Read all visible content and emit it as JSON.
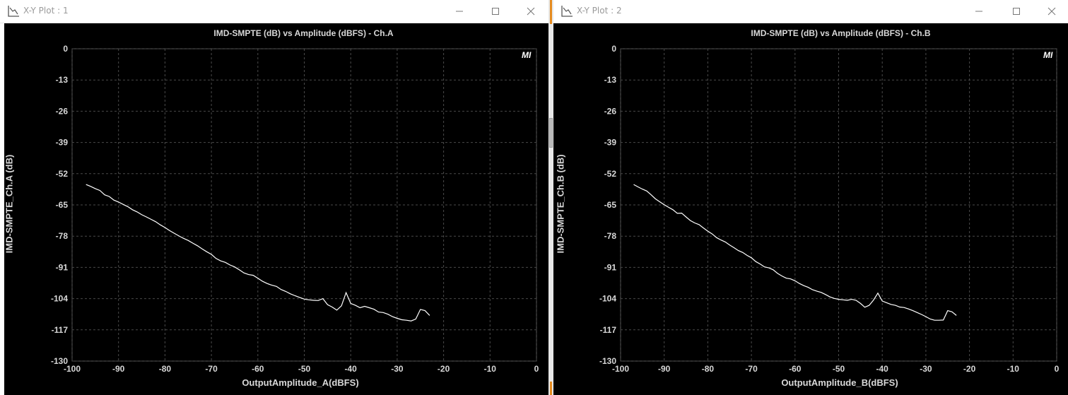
{
  "windows": [
    {
      "title": "X-Y Plot : 1",
      "controls": {
        "minimize": "minimize-icon",
        "maximize": "maximize-icon",
        "close": "close-icon"
      },
      "badge": "MI",
      "chart_data": {
        "type": "line",
        "title": "IMD-SMPTE (dB) vs Amplitude (dBFS) - Ch.A",
        "xlabel": "OutputAmplitude_A(dBFS)",
        "ylabel": "IMD-SMPTE_Ch.A (dB)",
        "xlim": [
          -100,
          0
        ],
        "ylim": [
          -130,
          0
        ],
        "xticks": [
          -100,
          -90,
          -80,
          -70,
          -60,
          -50,
          -40,
          -30,
          -20,
          -10,
          0
        ],
        "yticks": [
          0,
          -13,
          -26,
          -39,
          -52,
          -65,
          -78,
          -91,
          -104,
          -117,
          -130
        ],
        "grid": true,
        "line_color": "#ffffff",
        "series": [
          {
            "x": [
              -97,
              -96,
              -95,
              -94,
              -93,
              -92,
              -91,
              -90,
              -89,
              -88,
              -87,
              -86,
              -85,
              -84,
              -83,
              -82,
              -81,
              -80,
              -79,
              -78,
              -77,
              -76,
              -75,
              -74,
              -73,
              -72,
              -71,
              -70,
              -69,
              -68,
              -67,
              -66,
              -65,
              -64,
              -63,
              -62,
              -61,
              -60,
              -59,
              -58,
              -57,
              -56,
              -55,
              -54,
              -53,
              -52,
              -51,
              -50,
              -49,
              -48,
              -47,
              -46,
              -45,
              -44,
              -43,
              -42,
              -41,
              -40,
              -39,
              -38,
              -37,
              -36,
              -35,
              -34,
              -33,
              -32,
              -31,
              -30,
              -29,
              -28,
              -27,
              -26,
              -25,
              -24,
              -23
            ],
            "y": [
              -56.5,
              -57.3,
              -58.2,
              -59.0,
              -60.8,
              -61.5,
              -63.0,
              -63.8,
              -64.8,
              -65.7,
              -67.0,
              -67.9,
              -69.1,
              -70.0,
              -71.0,
              -72.0,
              -73.3,
              -74.4,
              -75.7,
              -76.8,
              -77.9,
              -78.9,
              -79.8,
              -80.9,
              -82.0,
              -83.3,
              -84.5,
              -85.6,
              -87.3,
              -88.3,
              -88.9,
              -90.0,
              -90.8,
              -92.0,
              -93.3,
              -94.0,
              -94.3,
              -95.5,
              -96.8,
              -97.7,
              -98.4,
              -98.9,
              -100.2,
              -101.0,
              -102.0,
              -102.8,
              -103.5,
              -104.2,
              -104.5,
              -104.7,
              -104.8,
              -104.0,
              -106.5,
              -107.5,
              -108.8,
              -107.0,
              -101.5,
              -106.0,
              -106.8,
              -107.8,
              -107.2,
              -107.8,
              -108.4,
              -109.6,
              -109.8,
              -110.5,
              -111.5,
              -112.2,
              -112.8,
              -113.0,
              -113.3,
              -112.5,
              -108.5,
              -109.0,
              -111.0
            ]
          }
        ]
      }
    },
    {
      "title": "X-Y Plot : 2",
      "controls": {
        "minimize": "minimize-icon",
        "maximize": "maximize-icon",
        "close": "close-icon"
      },
      "badge": "MI",
      "chart_data": {
        "type": "line",
        "title": "IMD-SMPTE (dB) vs Amplitude (dBFS) - Ch.B",
        "xlabel": "OutputAmplitude_B(dBFS)",
        "ylabel": "IMD-SMPTE_Ch.B (dB)",
        "xlim": [
          -100,
          0
        ],
        "ylim": [
          -130,
          0
        ],
        "xticks": [
          -100,
          -90,
          -80,
          -70,
          -60,
          -50,
          -40,
          -30,
          -20,
          -10,
          0
        ],
        "yticks": [
          0,
          -13,
          -26,
          -39,
          -52,
          -65,
          -78,
          -91,
          -104,
          -117,
          -130
        ],
        "grid": true,
        "line_color": "#ffffff",
        "series": [
          {
            "x": [
              -97,
              -96,
              -95,
              -94,
              -93,
              -92,
              -91,
              -90,
              -89,
              -88,
              -87,
              -86,
              -85,
              -84,
              -83,
              -82,
              -81,
              -80,
              -79,
              -78,
              -77,
              -76,
              -75,
              -74,
              -73,
              -72,
              -71,
              -70,
              -69,
              -68,
              -67,
              -66,
              -65,
              -64,
              -63,
              -62,
              -61,
              -60,
              -59,
              -58,
              -57,
              -56,
              -55,
              -54,
              -53,
              -52,
              -51,
              -50,
              -49,
              -48,
              -47,
              -46,
              -45,
              -44,
              -43,
              -42,
              -41,
              -40,
              -39,
              -38,
              -37,
              -36,
              -35,
              -34,
              -33,
              -32,
              -31,
              -30,
              -29,
              -28,
              -27,
              -26,
              -25,
              -24,
              -23
            ],
            "y": [
              -56.5,
              -57.5,
              -58.4,
              -59.2,
              -60.8,
              -62.5,
              -63.7,
              -64.9,
              -66.0,
              -67.0,
              -68.5,
              -68.4,
              -70.0,
              -71.5,
              -72.5,
              -73.2,
              -74.6,
              -75.9,
              -77.1,
              -78.6,
              -79.6,
              -80.4,
              -81.7,
              -82.8,
              -84.0,
              -84.8,
              -86.0,
              -87.0,
              -88.6,
              -89.6,
              -90.8,
              -91.2,
              -92.0,
              -93.5,
              -94.6,
              -95.5,
              -95.8,
              -96.6,
              -97.7,
              -98.6,
              -99.3,
              -100.3,
              -100.9,
              -101.4,
              -102.3,
              -103.3,
              -103.9,
              -104.3,
              -104.5,
              -104.7,
              -104.3,
              -104.7,
              -106.0,
              -107.6,
              -106.8,
              -104.6,
              -101.7,
              -105.0,
              -105.7,
              -106.4,
              -106.8,
              -107.5,
              -107.7,
              -108.3,
              -109.0,
              -109.8,
              -110.6,
              -111.5,
              -112.5,
              -113.0,
              -113.0,
              -112.9,
              -109.0,
              -109.5,
              -111.0
            ]
          }
        ]
      }
    }
  ]
}
